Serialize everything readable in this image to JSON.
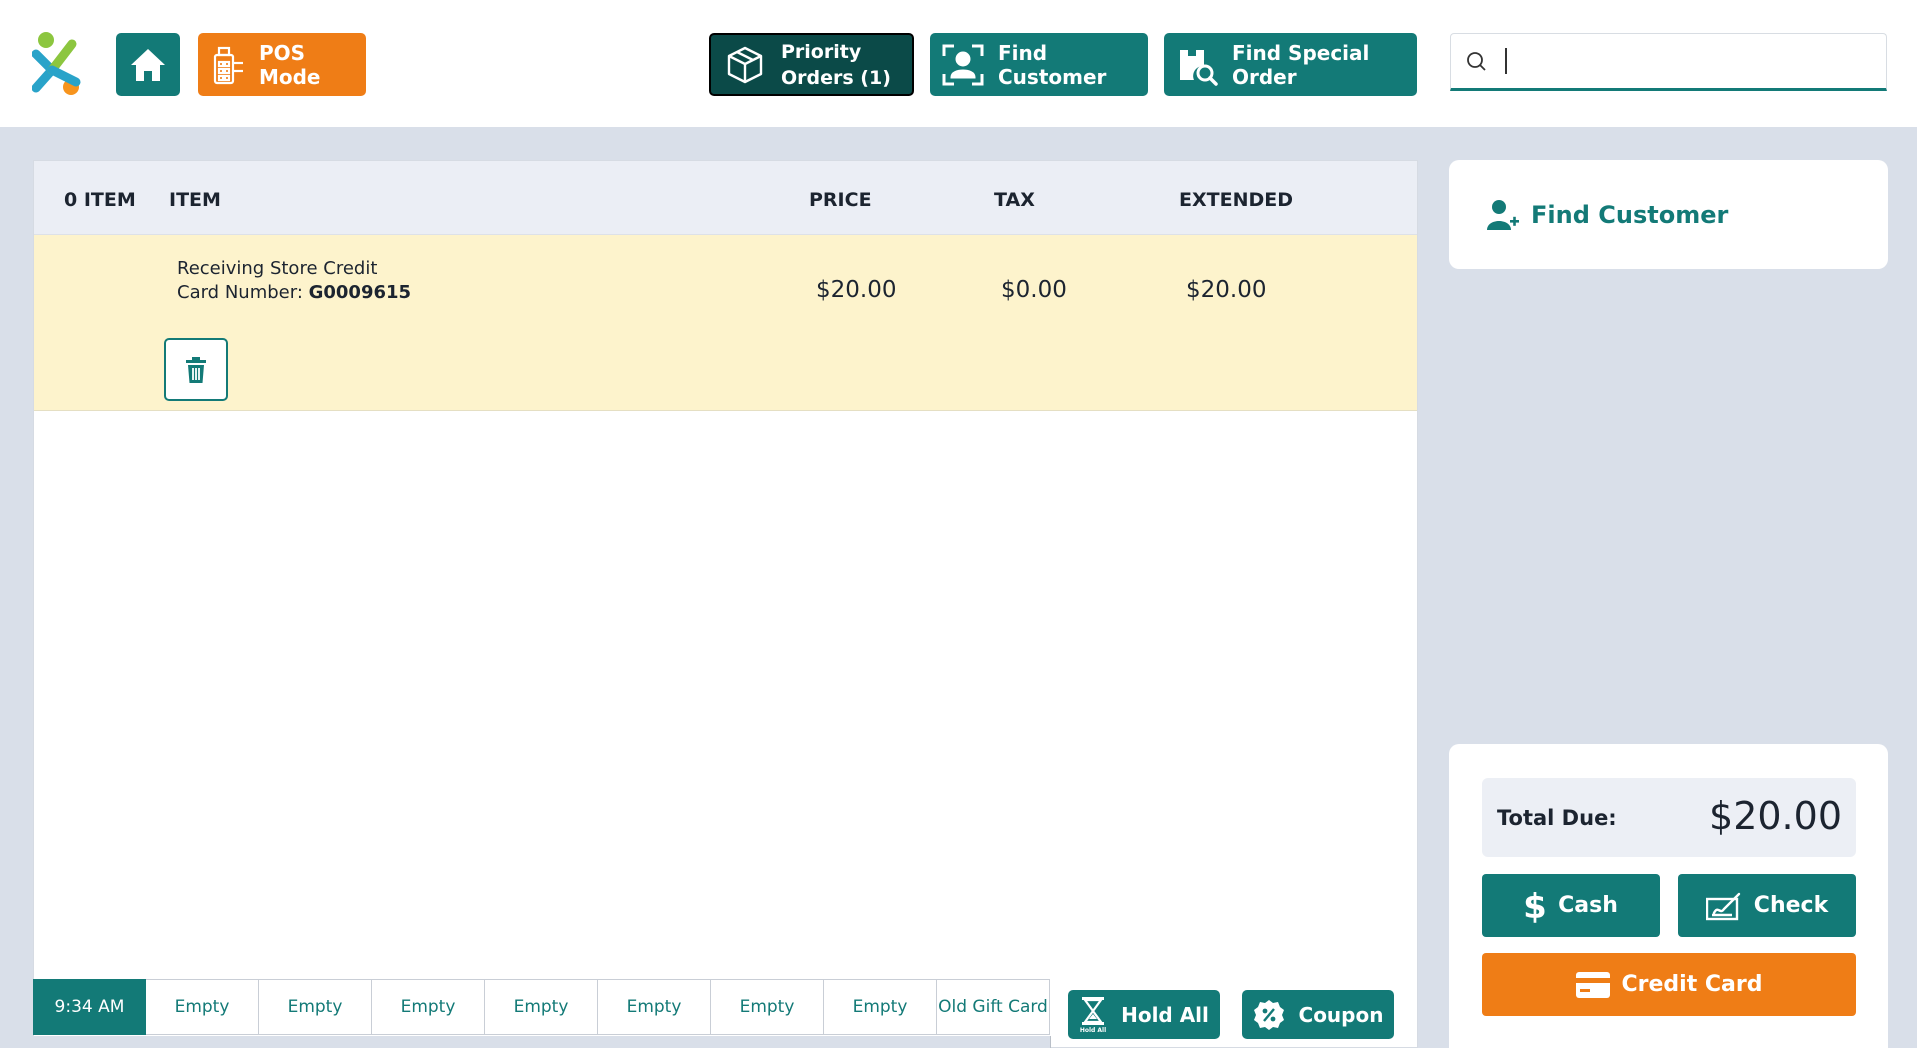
{
  "colors": {
    "brand_teal": "#137a77",
    "dark_teal": "#0b4a48",
    "orange": "#ef7d16",
    "highlight_row": "#fdf3cc"
  },
  "topbar": {
    "home_icon": "home-icon",
    "pos_mode_label": "POS Mode",
    "priority_label_line1": "Priority",
    "priority_label_line2": "Orders (1)",
    "find_customer_label": "Find Customer",
    "find_special_order_label": "Find Special Order",
    "search_value": ""
  },
  "table": {
    "columns": {
      "count": "0 ITEM",
      "item": "ITEM",
      "price": "PRICE",
      "tax": "TAX",
      "extended": "EXTENDED"
    },
    "rows": [
      {
        "description": "Receiving Store Credit",
        "card_label": "Card Number: ",
        "card_number": "G0009615",
        "price": "$20.00",
        "tax": "$0.00",
        "extended": "$20.00"
      }
    ]
  },
  "tabs": [
    "9:34 AM",
    "Empty",
    "Empty",
    "Empty",
    "Empty",
    "Empty",
    "Empty",
    "Empty",
    "Old Gift Card"
  ],
  "actions": {
    "hold_all_label": "Hold All",
    "hold_all_icon_caption": "Hold All",
    "coupon_label": "Coupon"
  },
  "customer_panel": {
    "find_customer_label": "Find Customer"
  },
  "payment": {
    "total_label": "Total Due:",
    "total_amount": "$20.00",
    "cash_label": "Cash",
    "check_label": "Check",
    "credit_label": "Credit Card"
  }
}
